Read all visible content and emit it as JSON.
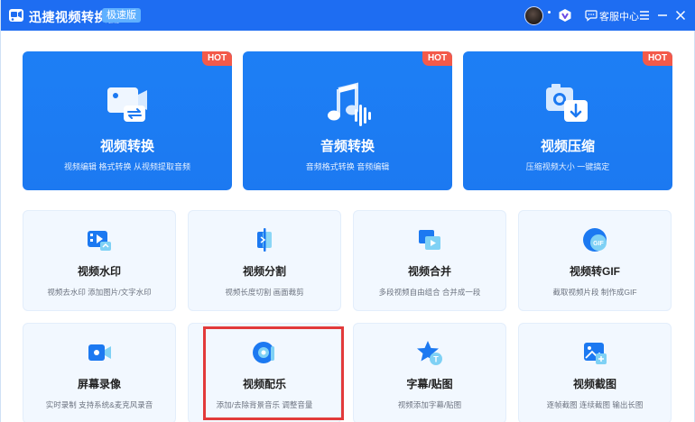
{
  "app": {
    "title": "迅捷视频转换器",
    "edition": "极速版"
  },
  "header": {
    "customer_service": "客服中心"
  },
  "colors": {
    "accent": "#1e6df2",
    "card_blue": "#1c79f1",
    "hot": "#f35a4a",
    "highlight": "#e23a3a"
  },
  "main_tools": [
    {
      "title": "视频转换",
      "desc": "视频编辑 格式转换 从视频提取音频",
      "badge": "HOT",
      "icon": "video-convert-icon"
    },
    {
      "title": "音频转换",
      "desc": "音频格式转换 音频编辑",
      "badge": "HOT",
      "icon": "audio-convert-icon"
    },
    {
      "title": "视频压缩",
      "desc": "压缩视频大小 一键搞定",
      "badge": "HOT",
      "icon": "video-compress-icon"
    }
  ],
  "tools": [
    {
      "title": "视频水印",
      "desc": "视频去水印 添加图片/文字水印",
      "icon": "watermark-icon"
    },
    {
      "title": "视频分割",
      "desc": "视频长度切割 画面裁剪",
      "icon": "split-icon"
    },
    {
      "title": "视频合并",
      "desc": "多段视频自由组合 合并成一段",
      "icon": "merge-icon"
    },
    {
      "title": "视频转GIF",
      "desc": "截取视频片段 制作成GIF",
      "icon": "gif-icon"
    },
    {
      "title": "屏幕录像",
      "desc": "实时录制 支持系统&麦克风录音",
      "icon": "screen-record-icon"
    },
    {
      "title": "视频配乐",
      "desc": "添加/去除背景音乐 调整音量",
      "icon": "music-icon"
    },
    {
      "title": "字幕/贴图",
      "desc": "视频添加字幕/贴图",
      "icon": "subtitle-icon"
    },
    {
      "title": "视频截图",
      "desc": "逐帧截图 连续截图 输出长图",
      "icon": "screenshot-icon"
    }
  ]
}
